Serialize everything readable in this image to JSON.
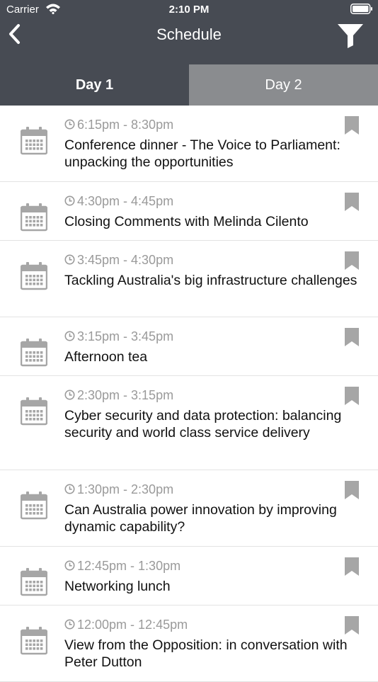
{
  "status_bar": {
    "carrier": "Carrier",
    "time": "2:10 PM",
    "icons": [
      "wifi-icon",
      "battery-icon"
    ]
  },
  "nav": {
    "title": "Schedule",
    "back_icon": "chevron-left-icon",
    "filter_icon": "filter-icon"
  },
  "tabs": [
    {
      "label": "Day 1",
      "selected": true
    },
    {
      "label": "Day 2",
      "selected": false
    }
  ],
  "sessions": [
    {
      "time": "6:15pm - 8:30pm",
      "title": "Conference dinner - The Voice to Parliament: unpacking the opportunities"
    },
    {
      "time": "4:30pm - 4:45pm",
      "title": "Closing Comments with Melinda Cilento"
    },
    {
      "time": "3:45pm - 4:30pm",
      "title": "Tackling Australia's big infrastructure challenges"
    },
    {
      "time": "3:15pm - 3:45pm",
      "title": "Afternoon tea"
    },
    {
      "time": "2:30pm - 3:15pm",
      "title": "Cyber security and data protection: balancing security and world class service delivery"
    },
    {
      "time": "1:30pm - 2:30pm",
      "title": "Can Australia power innovation by improving dynamic capability?"
    },
    {
      "time": "12:45pm - 1:30pm",
      "title": "Networking lunch"
    },
    {
      "time": "12:00pm - 12:45pm",
      "title": "View from the Opposition: in conversation with Peter Dutton"
    }
  ],
  "colors": {
    "header": "#474b53",
    "tab_inactive": "#8a8c8f",
    "icon_gray": "#a6a6a6",
    "time_text": "#9a9a9a"
  }
}
